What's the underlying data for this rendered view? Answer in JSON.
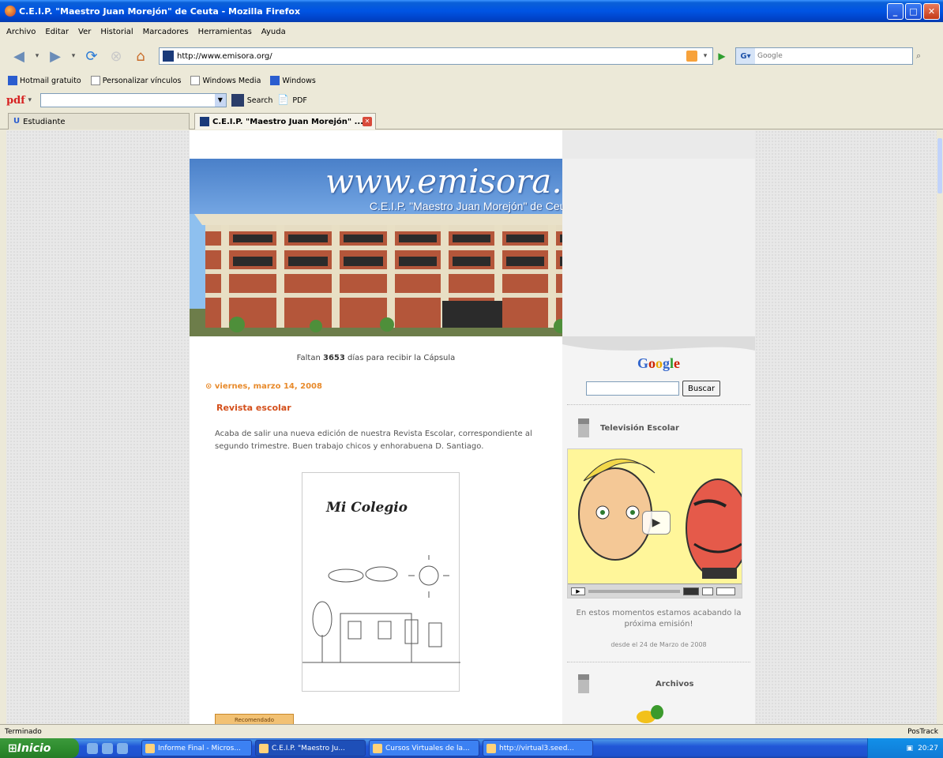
{
  "window": {
    "title": "C.E.I.P. \"Maestro Juan Morejón\" de Ceuta - Mozilla Firefox"
  },
  "menu": [
    "Archivo",
    "Editar",
    "Ver",
    "Historial",
    "Marcadores",
    "Herramientas",
    "Ayuda"
  ],
  "nav": {
    "url": "http://www.emisora.org/",
    "search_placeholder": "Google"
  },
  "bookmarks": [
    "Hotmail gratuito",
    "Personalizar vínculos",
    "Windows Media",
    "Windows"
  ],
  "pdf_toolbar": {
    "logo": "pdf",
    "search_label": "Search",
    "pdf_label": "PDF"
  },
  "tabs": [
    {
      "label": "Estudiante"
    },
    {
      "label": "C.E.I.P. \"Maestro Juan Morejón\" ..."
    }
  ],
  "page": {
    "site_title": "www.emisora.org",
    "site_subtitle": "C.E.I.P. \"Maestro Juan Morejón\" de Ceuta",
    "countdown_prefix": "Faltan",
    "countdown_days": "3653",
    "countdown_suffix": "días para recibir la Cápsula",
    "post": {
      "date": "viernes, marzo 14, 2008",
      "title": "Revista escolar",
      "body": "Acaba de salir una nueva edición de nuestra Revista Escolar, correspondiente al segundo trimestre. Buen trabajo chicos y enhorabuena D. Santiago.",
      "magazine_title": "Mi Colegio"
    },
    "badge": "Recomendado",
    "sidebar": {
      "search_button": "Buscar",
      "tv_heading": "Televisión Escolar",
      "video_message": "En estos momentos estamos acabando la próxima emisión!",
      "video_date": "desde el 24 de Marzo de 2008",
      "archive_heading": "Archivos"
    }
  },
  "status": {
    "left": "Terminado",
    "right": "PosTrack"
  },
  "taskbar": {
    "start": "Inicio",
    "items": [
      "Informe Final - Micros...",
      "C.E.I.P. \"Maestro Ju...",
      "Cursos Virtuales de la...",
      "http://virtual3.seed..."
    ],
    "clock": "20:27"
  }
}
